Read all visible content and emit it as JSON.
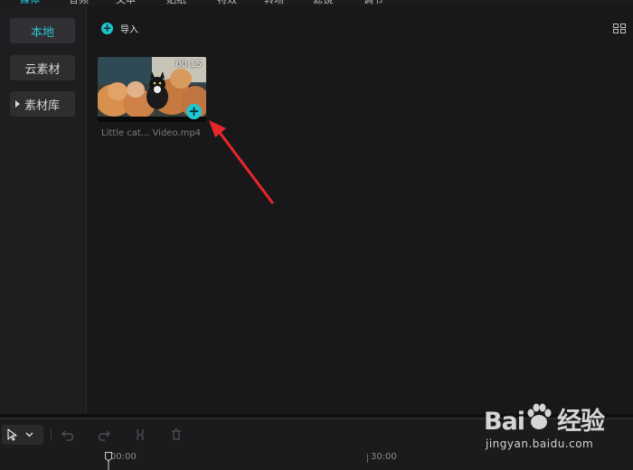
{
  "top_tabs": [
    {
      "label": "媒体",
      "active": true
    },
    {
      "label": "音频"
    },
    {
      "label": "文本"
    },
    {
      "label": "贴纸"
    },
    {
      "label": "特效"
    },
    {
      "label": "转场"
    },
    {
      "label": "滤镜"
    },
    {
      "label": "调节"
    }
  ],
  "sidebar": {
    "items": [
      {
        "label": "本地",
        "active": true
      },
      {
        "label": "云素材"
      },
      {
        "label": "素材库"
      }
    ]
  },
  "main": {
    "import_label": "导入",
    "media": {
      "duration": "00:15",
      "file_name": "Little cat... Video.mp4"
    }
  },
  "timeline": {
    "ruler_labels": [
      "00:00",
      "30:00"
    ]
  },
  "watermark": {
    "brand": "Bai 经验",
    "url": "jingyan.baidu.com"
  },
  "colors": {
    "accent": "#20c4cf",
    "annotation_arrow": "#e8262b"
  }
}
